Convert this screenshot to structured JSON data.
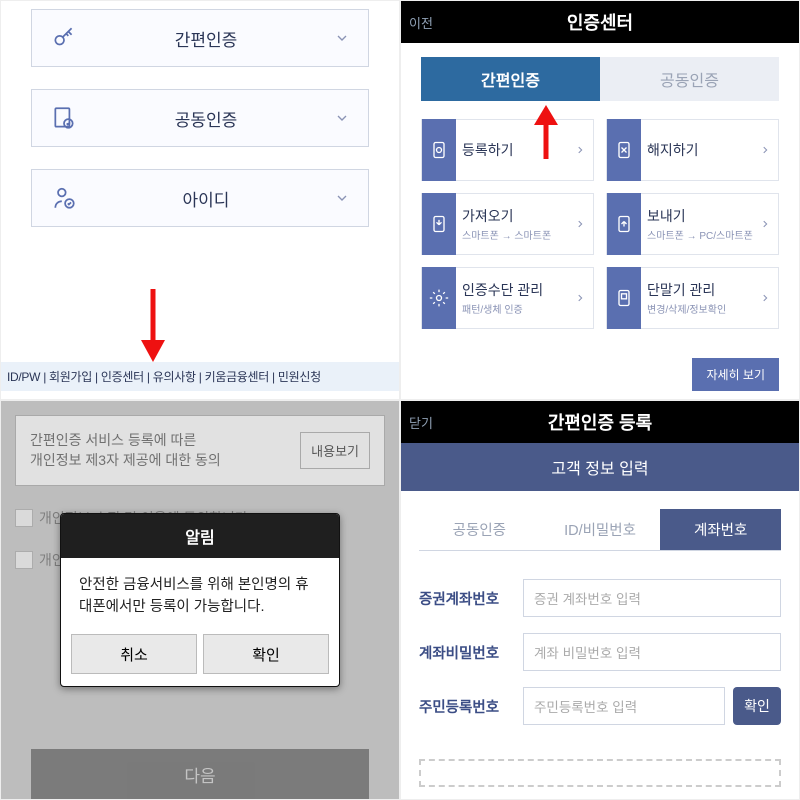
{
  "q1": {
    "options": [
      {
        "label": "간편인증",
        "icon": "key-icon"
      },
      {
        "label": "공동인증",
        "icon": "doc-check-icon"
      },
      {
        "label": "아이디",
        "icon": "person-icon"
      }
    ],
    "footer": "ID/PW | 회원가입 | 인증센터 | 유의사항 | 키움금융센터 | 민원신청"
  },
  "q2": {
    "back": "이전",
    "title": "인증센터",
    "seg_active": "간편인증",
    "seg_inactive": "공동인증",
    "menu": [
      {
        "main": "등록하기",
        "sub": "",
        "icon": "register-icon"
      },
      {
        "main": "해지하기",
        "sub": "",
        "icon": "cancel-icon"
      },
      {
        "main": "가져오기",
        "sub": "스마트폰 → 스마트폰",
        "icon": "download-icon"
      },
      {
        "main": "보내기",
        "sub": "스마트폰 → PC/스마트폰",
        "icon": "upload-icon"
      },
      {
        "main": "인증수단 관리",
        "sub": "패턴/생체 인증",
        "icon": "gear-icon"
      },
      {
        "main": "단말기 관리",
        "sub": "변경/삭제/정보확인",
        "icon": "device-icon"
      }
    ],
    "detail": "자세히 보기"
  },
  "q3": {
    "consent_line1": "간편인증 서비스 등록에 따른",
    "consent_line2": "개인정보 제3자 제공에 대한 동의",
    "view": "내용보기",
    "chk1": "개인정보 수집 및 이용에 동의합니다.",
    "chk2": "개인",
    "modal_title": "알림",
    "modal_body": "안전한 금융서비스를 위해 본인명의 휴대폰에서만 등록이 가능합니다.",
    "cancel": "취소",
    "confirm": "확인",
    "next": "다음"
  },
  "q4": {
    "close": "닫기",
    "title": "간편인증 등록",
    "sub": "고객 정보 입력",
    "tabs": [
      "공동인증",
      "ID/비밀번호",
      "계좌번호"
    ],
    "active_tab": 2,
    "fields": [
      {
        "label": "증권계좌번호",
        "placeholder": "증권 계좌번호 입력"
      },
      {
        "label": "계좌비밀번호",
        "placeholder": "계좌 비밀번호 입력"
      },
      {
        "label": "주민등록번호",
        "placeholder": "주민등록번호 입력"
      }
    ],
    "ok": "확인"
  }
}
